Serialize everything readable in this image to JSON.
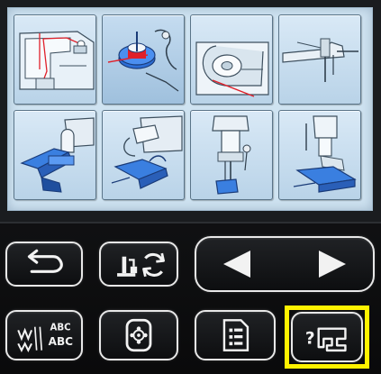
{
  "screen": {
    "title": "",
    "tiles": [
      {
        "id": "upper-threading",
        "icon": "upper-threading-illustration",
        "active": false
      },
      {
        "id": "bobbin-winding",
        "icon": "bobbin-winding-illustration",
        "active": true
      },
      {
        "id": "bobbin-insertion",
        "icon": "bobbin-case-illustration",
        "active": false
      },
      {
        "id": "needle-threading",
        "icon": "needle-threader-illustration",
        "active": false
      },
      {
        "id": "presser-foot-attach",
        "icon": "presser-foot-attach-illustration",
        "active": false
      },
      {
        "id": "presser-foot-remove",
        "icon": "presser-foot-remove-illustration",
        "active": false
      },
      {
        "id": "presser-foot-holder",
        "icon": "presser-foot-holder-illustration",
        "active": false
      },
      {
        "id": "zipper-foot",
        "icon": "zipper-foot-illustration",
        "active": false
      }
    ]
  },
  "buttons": {
    "back": {
      "icon": "return-arrow-icon"
    },
    "needle_change": {
      "icon": "presser-foot-refresh-icon"
    },
    "prev": {
      "icon": "triangle-left-icon"
    },
    "next": {
      "icon": "triangle-right-icon"
    },
    "stitch": {
      "icon": "stitch-abc-icon",
      "text_top": "ABC",
      "text_mid": "ABC"
    },
    "embroidery": {
      "icon": "embroidery-hoop-icon"
    },
    "settings": {
      "icon": "settings-list-icon"
    },
    "help": {
      "icon": "machine-help-icon",
      "symbol": "?"
    }
  },
  "colors": {
    "accent_highlight": "#fff200",
    "lcd_background": "#cfe3f1",
    "thread_red": "#e0202a"
  }
}
